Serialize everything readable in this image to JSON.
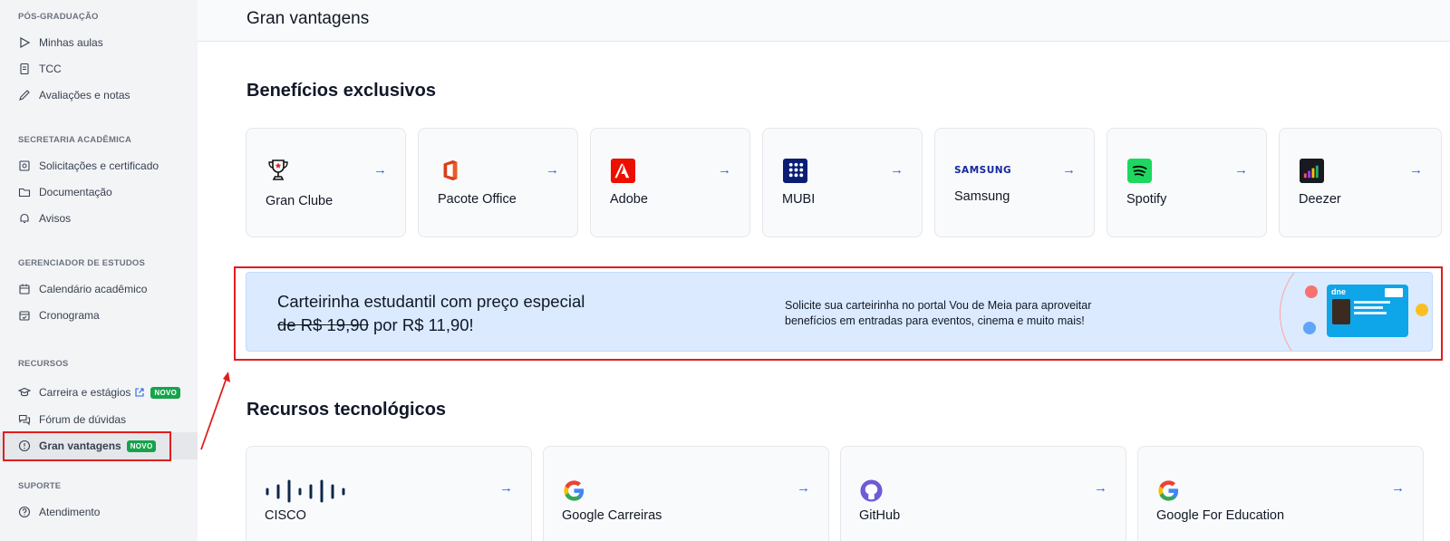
{
  "sidebar": {
    "sections": [
      {
        "title": "PÓS-GRADUAÇÃO",
        "items": [
          {
            "label": "Minhas aulas"
          },
          {
            "label": "TCC"
          },
          {
            "label": "Avaliações e notas"
          }
        ]
      },
      {
        "title": "SECRETARIA ACADÊMICA",
        "items": [
          {
            "label": "Solicitações e certificado"
          },
          {
            "label": "Documentação"
          },
          {
            "label": "Avisos"
          }
        ]
      },
      {
        "title": "GERENCIADOR DE ESTUDOS",
        "items": [
          {
            "label": "Calendário acadêmico"
          },
          {
            "label": "Cronograma"
          }
        ]
      },
      {
        "title": "RECURSOS",
        "items": [
          {
            "label": "Carreira e estágios",
            "badge": "NOVO"
          },
          {
            "label": "Fórum de dúvidas"
          },
          {
            "label": "Gran vantagens",
            "badge": "NOVO"
          }
        ]
      },
      {
        "title": "SUPORTE",
        "items": [
          {
            "label": "Atendimento"
          }
        ]
      }
    ],
    "active_item": "Gran vantagens"
  },
  "header": {
    "title": "Gran vantagens"
  },
  "benefits": {
    "heading": "Benefícios exclusivos",
    "cards": [
      {
        "label": "Gran Clube",
        "icon": "trophy-icon"
      },
      {
        "label": "Pacote Office",
        "icon": "office-icon"
      },
      {
        "label": "Adobe",
        "icon": "adobe-icon"
      },
      {
        "label": "MUBI",
        "icon": "mubi-icon"
      },
      {
        "label": "Samsung",
        "icon": "samsung-logo",
        "logo_text": "SAMSUNG"
      },
      {
        "label": "Spotify",
        "icon": "spotify-icon"
      },
      {
        "label": "Deezer",
        "icon": "deezer-icon"
      }
    ]
  },
  "banner": {
    "title": "Carteirinha estudantil com preço especial",
    "old_price": "de R$ 19,90",
    "new_price": " por R$ 11,90!",
    "description": "Solicite sua carteirinha no portal Vou de Meia para aproveitar benefícios em entradas para eventos, cinema e muito mais!",
    "card_brand": "dne"
  },
  "tech": {
    "heading": "Recursos tecnológicos",
    "cards": [
      {
        "label": "CISCO",
        "icon": "cisco-icon"
      },
      {
        "label": "Google Carreiras",
        "icon": "google-icon"
      },
      {
        "label": "GitHub",
        "icon": "github-icon"
      },
      {
        "label": "Google For Education",
        "icon": "google-icon"
      }
    ]
  },
  "colors": {
    "accent": "#2563eb",
    "badge": "#16a34a",
    "highlight": "#e11d1d",
    "banner_bg": "#dbeafe"
  }
}
